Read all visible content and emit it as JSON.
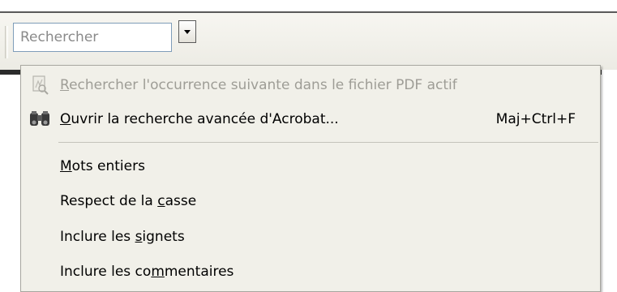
{
  "search": {
    "placeholder": "Rechercher"
  },
  "menu": {
    "items": [
      {
        "before": "",
        "ul": "R",
        "after": "echercher l'occurrence suivante dans le fichier PDF actif",
        "shortcut": "",
        "icon": "pdf-search-icon",
        "disabled": true
      },
      {
        "before": "",
        "ul": "O",
        "after": "uvrir la recherche avancée d'Acrobat...",
        "shortcut": "Maj+Ctrl+F",
        "icon": "binoculars-icon",
        "disabled": false
      },
      {
        "before": "",
        "ul": "M",
        "after": "ots entiers",
        "shortcut": "",
        "icon": "",
        "disabled": false
      },
      {
        "before": "Respect de la ",
        "ul": "c",
        "after": "asse",
        "shortcut": "",
        "icon": "",
        "disabled": false
      },
      {
        "before": "Inclure les ",
        "ul": "s",
        "after": "ignets",
        "shortcut": "",
        "icon": "",
        "disabled": false
      },
      {
        "before": "Inclure les co",
        "ul": "m",
        "after": "mentaires",
        "shortcut": "",
        "icon": "",
        "disabled": false
      }
    ]
  }
}
